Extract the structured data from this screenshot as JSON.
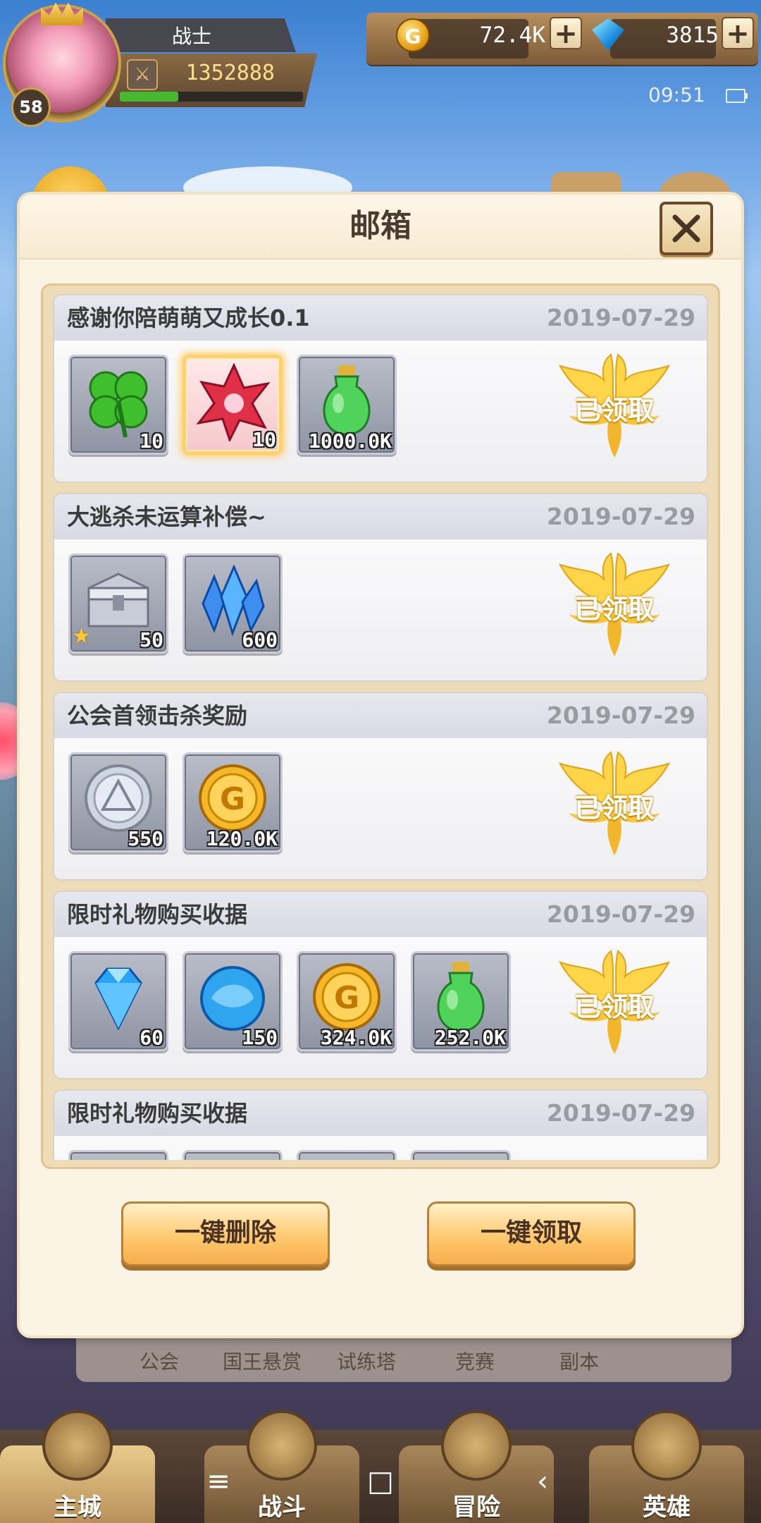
{
  "player": {
    "level": "58",
    "class_name": "战士",
    "power": "1352888",
    "exp_fraction": 0.32
  },
  "resources": {
    "gold": "72.4K",
    "diamonds": "3815"
  },
  "status_bar": {
    "time": "09:51"
  },
  "modal": {
    "title": "邮箱",
    "close_icon": "close-icon"
  },
  "mails": [
    {
      "title": "感谢你陪萌萌又成长0.1",
      "date": "2019-07-29",
      "status": "已领取",
      "items": [
        {
          "icon": "clover-icon",
          "qty": "10"
        },
        {
          "icon": "red-crystal-icon",
          "qty": "10",
          "highlight": true
        },
        {
          "icon": "green-potion-icon",
          "qty": "1000.0K"
        }
      ]
    },
    {
      "title": "大逃杀未运算补偿~",
      "date": "2019-07-29",
      "status": "已领取",
      "items": [
        {
          "icon": "silver-chest-icon",
          "qty": "50",
          "star": true
        },
        {
          "icon": "blue-crystal-icon",
          "qty": "600"
        }
      ]
    },
    {
      "title": "公会首领击杀奖励",
      "date": "2019-07-29",
      "status": "已领取",
      "items": [
        {
          "icon": "silver-coin-icon",
          "qty": "550"
        },
        {
          "icon": "gold-coin-icon",
          "qty": "120.0K"
        }
      ]
    },
    {
      "title": "限时礼物购买收据",
      "date": "2019-07-29",
      "status": "已领取",
      "items": [
        {
          "icon": "diamond-icon",
          "qty": "60"
        },
        {
          "icon": "blue-orb-icon",
          "qty": "150"
        },
        {
          "icon": "gold-coin-icon",
          "qty": "324.0K"
        },
        {
          "icon": "green-potion-icon",
          "qty": "252.0K"
        }
      ]
    },
    {
      "title": "限时礼物购买收据",
      "date": "2019-07-29",
      "status": "",
      "items": []
    }
  ],
  "actions": {
    "delete_all": "一键删除",
    "claim_all": "一键领取"
  },
  "sub_menu": [
    "公会",
    "国王悬赏",
    "试练塔",
    "竞赛",
    "副本"
  ],
  "bottom_nav": [
    {
      "label": "主城",
      "active": true
    },
    {
      "label": "战斗",
      "active": false
    },
    {
      "label": "冒险",
      "active": false
    },
    {
      "label": "英雄",
      "active": false
    }
  ],
  "system_nav": {
    "menu_icon": "≡",
    "home_icon": "□",
    "back_icon": "‹"
  }
}
